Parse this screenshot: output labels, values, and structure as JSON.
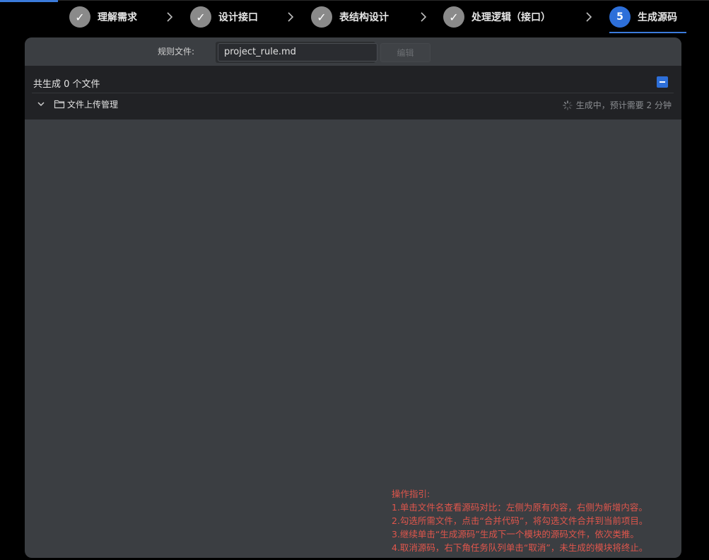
{
  "steps": [
    {
      "marker": "✓",
      "label": "理解需求",
      "status": "done"
    },
    {
      "marker": "✓",
      "label": "设计接口",
      "status": "done"
    },
    {
      "marker": "✓",
      "label": "表结构设计",
      "status": "done"
    },
    {
      "marker": "✓",
      "label": "处理逻辑（接口）",
      "status": "done"
    },
    {
      "marker": "5",
      "label": "生成源码",
      "status": "active"
    }
  ],
  "rule": {
    "label": "规则文件:",
    "value": "project_rule.md",
    "edit_label": "编辑"
  },
  "files": {
    "count_text": "共生成 0 个文件",
    "folder": {
      "name": "文件上传管理",
      "status": "生成中，预计需要 2 分钟"
    }
  },
  "guide": {
    "title": "操作指引:",
    "lines": [
      "1.单击文件名查看源码对比：左侧为原有内容，右侧为新增内容。",
      "2.勾选所需文件，点击“合并代码”，将勾选文件合并到当前项目。",
      "3.继续单击“生成源码”生成下一个模块的源码文件，依次类推。",
      "4.取消源码，右下角任务队列单击“取消”，未生成的模块将终止。"
    ]
  },
  "colors": {
    "accent": "#2d6fd9",
    "guide_text": "#e0564c",
    "step_done": "#8a8a8a"
  }
}
